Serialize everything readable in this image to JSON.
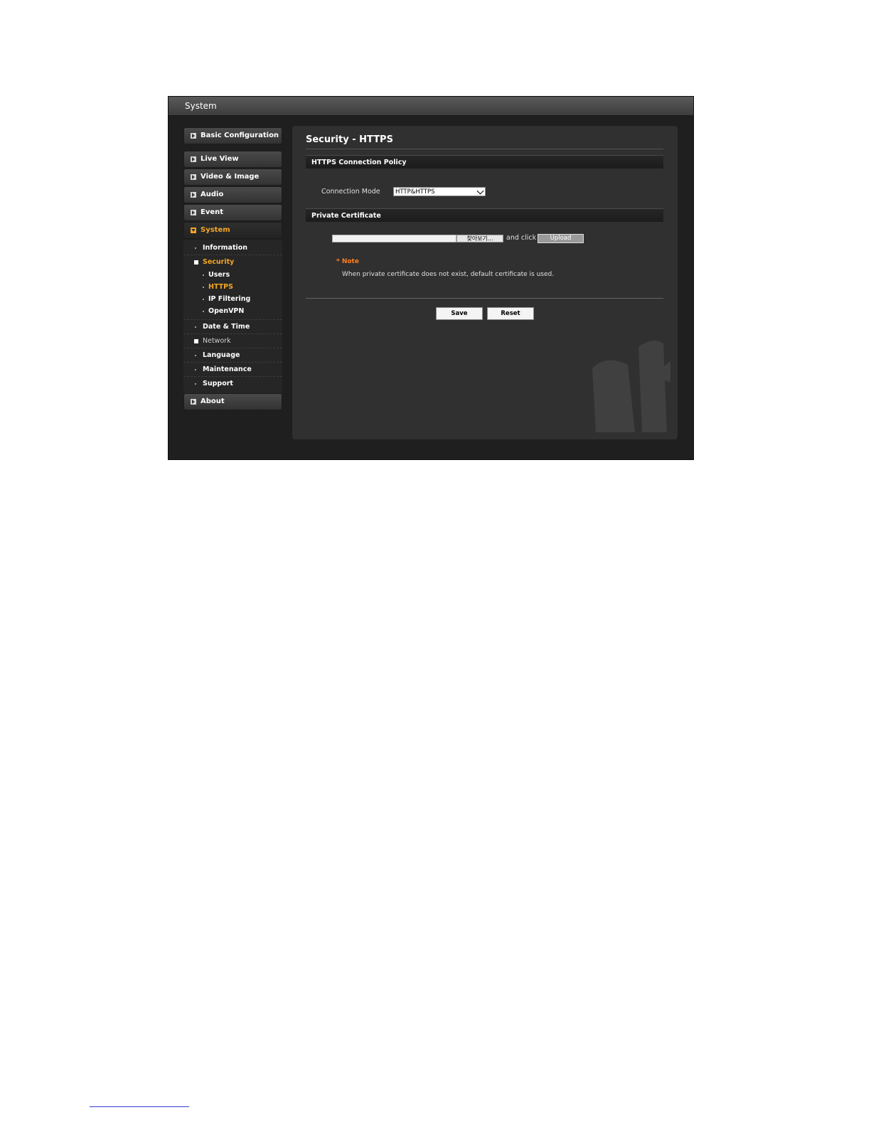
{
  "window": {
    "title": "System"
  },
  "sidebar": {
    "top": {
      "label": "Basic Configuration"
    },
    "items": [
      {
        "label": "Live View"
      },
      {
        "label": "Video & Image"
      },
      {
        "label": "Audio"
      },
      {
        "label": "Event"
      },
      {
        "label": "System"
      }
    ],
    "system_sub": {
      "information": "Information",
      "security": "Security",
      "security_items": [
        "Users",
        "HTTPS",
        "IP Filtering",
        "OpenVPN"
      ],
      "date_time": "Date & Time",
      "network": "Network",
      "language": "Language",
      "maintenance": "Maintenance",
      "support": "Support"
    },
    "about": {
      "label": "About"
    }
  },
  "main": {
    "title": "Security - HTTPS",
    "section1": {
      "header": "HTTPS Connection Policy",
      "field_label": "Connection Mode",
      "field_value": "HTTP&HTTPS"
    },
    "section2": {
      "header": "Private Certificate",
      "browse_label": "찾아보기...",
      "and_click": "and click",
      "upload_label": "Upload"
    },
    "note": {
      "title": "* Note",
      "text": "When private certificate does not exist, default certificate is used."
    },
    "buttons": {
      "save": "Save",
      "reset": "Reset"
    }
  },
  "colors": {
    "accent": "#f5a623",
    "note": "#ff7f1f",
    "background": "#1f1f1f",
    "panel": "#303030"
  }
}
